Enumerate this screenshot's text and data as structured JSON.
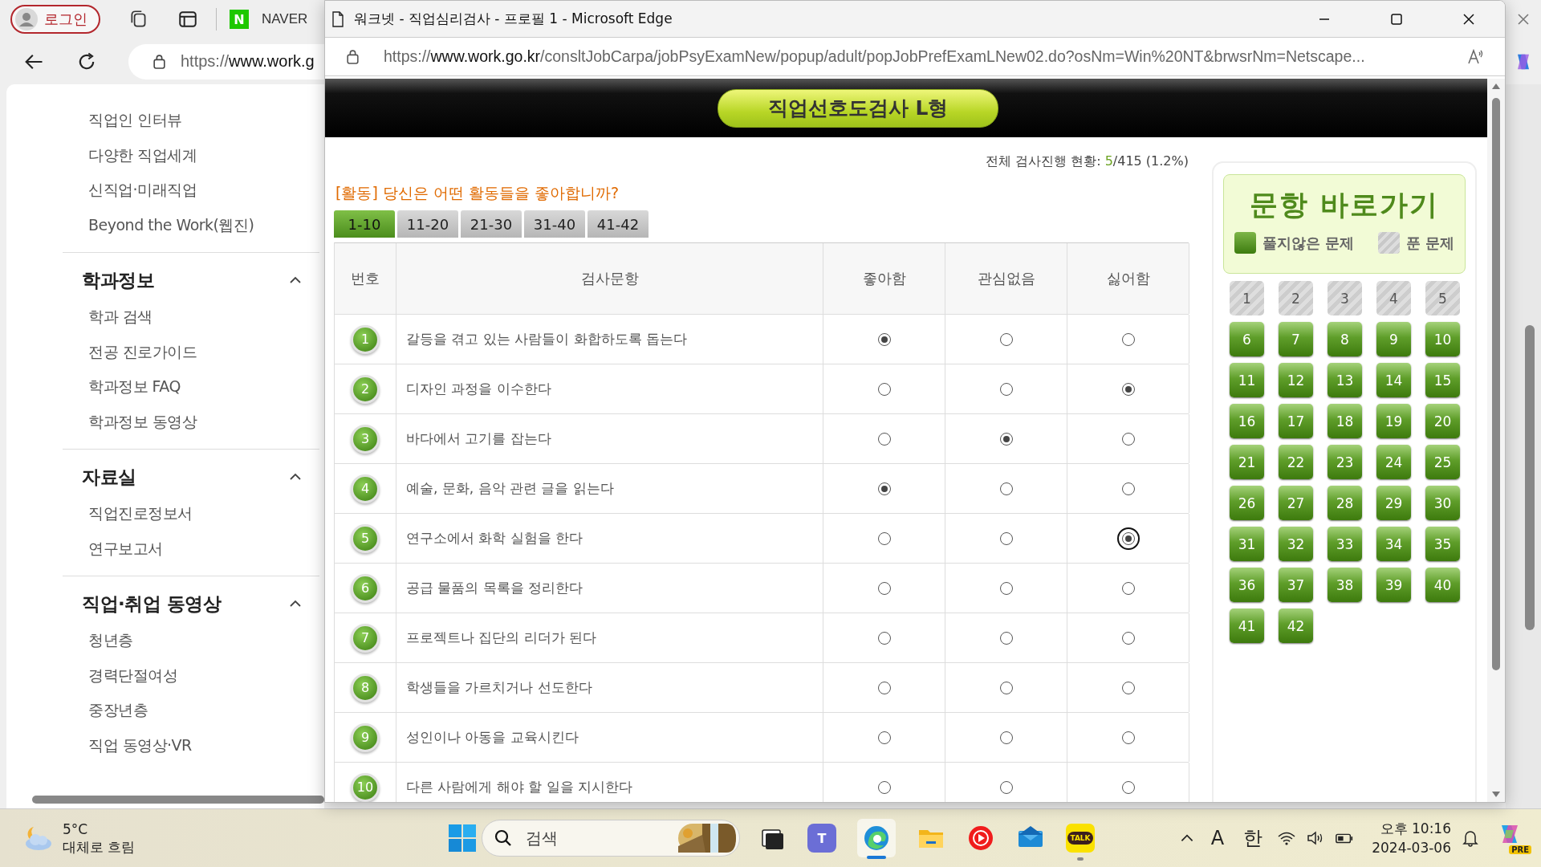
{
  "browser": {
    "login_button": "로그인",
    "naver_letter": "N",
    "bookmark": "NAVER",
    "url": {
      "scheme": "https://",
      "host": "www.work.g"
    }
  },
  "sidebar": {
    "items": [
      "직업인 인터뷰",
      "다양한 직업세계",
      "신직업·미래직업",
      "Beyond the Work(웹진)"
    ],
    "sections": [
      {
        "title": "학과정보",
        "expanded": true,
        "items": [
          "학과 검색",
          "전공 진로가이드",
          "학과정보 FAQ",
          "학과정보 동영상"
        ]
      },
      {
        "title": "자료실",
        "expanded": true,
        "items": [
          "직업진로정보서",
          "연구보고서"
        ]
      },
      {
        "title": "직업·취업 동영상",
        "expanded": true,
        "items": [
          "청년층",
          "경력단절여성",
          "중장년층",
          "직업 동영상·VR"
        ]
      }
    ]
  },
  "popup": {
    "title": "워크넷 - 직업심리검사 - 프로필 1 - Microsoft Edge",
    "url": {
      "scheme": "https://",
      "host": "www.work.go.kr",
      "path": "/consltJobCarpa/jobPsyExamNew/popup/adult/popJobPrefExamLNew02.do?osNm=Win%20NT&brwsrNm=Netscape..."
    },
    "banner": "직업선호도검사 L형",
    "progress": {
      "label": "전체 검사진행 현황: ",
      "done": "5",
      "rest": "/415 (1.2%)"
    },
    "question": "[활동] 당신은 어떤 활동들을 좋아합니까?",
    "tabs": [
      {
        "label": "1-10",
        "selected": true
      },
      {
        "label": "11-20",
        "selected": false
      },
      {
        "label": "21-30",
        "selected": false
      },
      {
        "label": "31-40",
        "selected": false
      },
      {
        "label": "41-42",
        "selected": false
      }
    ],
    "table": {
      "columns": [
        "번호",
        "검사문항",
        "좋아함",
        "관심없음",
        "싫어함"
      ],
      "rows": [
        {
          "number": "1",
          "text": "갈등을 겪고 있는 사람들이 화합하도록 돕는다",
          "choices": [
            {
              "selected": true,
              "focused": false
            },
            {
              "selected": false,
              "focused": false
            },
            {
              "selected": false,
              "focused": false
            }
          ]
        },
        {
          "number": "2",
          "text": "디자인 과정을 이수한다",
          "choices": [
            {
              "selected": false,
              "focused": false
            },
            {
              "selected": false,
              "focused": false
            },
            {
              "selected": true,
              "focused": false
            }
          ]
        },
        {
          "number": "3",
          "text": "바다에서 고기를 잡는다",
          "choices": [
            {
              "selected": false,
              "focused": false
            },
            {
              "selected": true,
              "focused": false
            },
            {
              "selected": false,
              "focused": false
            }
          ]
        },
        {
          "number": "4",
          "text": "예술, 문화, 음악 관련 글을 읽는다",
          "choices": [
            {
              "selected": true,
              "focused": false
            },
            {
              "selected": false,
              "focused": false
            },
            {
              "selected": false,
              "focused": false
            }
          ]
        },
        {
          "number": "5",
          "text": "연구소에서 화학 실험을 한다",
          "choices": [
            {
              "selected": false,
              "focused": false
            },
            {
              "selected": false,
              "focused": false
            },
            {
              "selected": true,
              "focused": true
            }
          ]
        },
        {
          "number": "6",
          "text": "공급 물품의 목록을 정리한다",
          "choices": [
            {
              "selected": false,
              "focused": false
            },
            {
              "selected": false,
              "focused": false
            },
            {
              "selected": false,
              "focused": false
            }
          ]
        },
        {
          "number": "7",
          "text": "프로젝트나 집단의 리더가 된다",
          "choices": [
            {
              "selected": false,
              "focused": false
            },
            {
              "selected": false,
              "focused": false
            },
            {
              "selected": false,
              "focused": false
            }
          ]
        },
        {
          "number": "8",
          "text": "학생들을 가르치거나 선도한다",
          "choices": [
            {
              "selected": false,
              "focused": false
            },
            {
              "selected": false,
              "focused": false
            },
            {
              "selected": false,
              "focused": false
            }
          ]
        },
        {
          "number": "9",
          "text": "성인이나 아동을 교육시킨다",
          "choices": [
            {
              "selected": false,
              "focused": false
            },
            {
              "selected": false,
              "focused": false
            },
            {
              "selected": false,
              "focused": false
            }
          ]
        },
        {
          "number": "10",
          "text": "다른 사람에게 해야 할 일을 지시한다",
          "choices": [
            {
              "selected": false,
              "focused": false
            },
            {
              "selected": false,
              "focused": false
            },
            {
              "selected": false,
              "focused": false
            }
          ]
        }
      ]
    },
    "nav": {
      "title": "문항 바로가기",
      "legend": [
        {
          "kind": "unanswered",
          "label": "풀지않은 문제"
        },
        {
          "kind": "answered",
          "label": "푼 문제"
        }
      ],
      "items": [
        {
          "label": "1",
          "answered": true
        },
        {
          "label": "2",
          "answered": true
        },
        {
          "label": "3",
          "answered": true
        },
        {
          "label": "4",
          "answered": true
        },
        {
          "label": "5",
          "answered": true
        },
        {
          "label": "6",
          "answered": false
        },
        {
          "label": "7",
          "answered": false
        },
        {
          "label": "8",
          "answered": false
        },
        {
          "label": "9",
          "answered": false
        },
        {
          "label": "10",
          "answered": false
        },
        {
          "label": "11",
          "answered": false
        },
        {
          "label": "12",
          "answered": false
        },
        {
          "label": "13",
          "answered": false
        },
        {
          "label": "14",
          "answered": false
        },
        {
          "label": "15",
          "answered": false
        },
        {
          "label": "16",
          "answered": false
        },
        {
          "label": "17",
          "answered": false
        },
        {
          "label": "18",
          "answered": false
        },
        {
          "label": "19",
          "answered": false
        },
        {
          "label": "20",
          "answered": false
        },
        {
          "label": "21",
          "answered": false
        },
        {
          "label": "22",
          "answered": false
        },
        {
          "label": "23",
          "answered": false
        },
        {
          "label": "24",
          "answered": false
        },
        {
          "label": "25",
          "answered": false
        },
        {
          "label": "26",
          "answered": false
        },
        {
          "label": "27",
          "answered": false
        },
        {
          "label": "28",
          "answered": false
        },
        {
          "label": "29",
          "answered": false
        },
        {
          "label": "30",
          "answered": false
        },
        {
          "label": "31",
          "answered": false
        },
        {
          "label": "32",
          "answered": false
        },
        {
          "label": "33",
          "answered": false
        },
        {
          "label": "34",
          "answered": false
        },
        {
          "label": "35",
          "answered": false
        },
        {
          "label": "36",
          "answered": false
        },
        {
          "label": "37",
          "answered": false
        },
        {
          "label": "38",
          "answered": false
        },
        {
          "label": "39",
          "answered": false
        },
        {
          "label": "40",
          "answered": false
        },
        {
          "label": "41",
          "answered": false
        },
        {
          "label": "42",
          "answered": false
        }
      ]
    }
  },
  "taskbar": {
    "weather": {
      "temp": "5°C",
      "condition": "대체로 흐림"
    },
    "search": {
      "placeholder": "검색"
    },
    "teams_letter": "T",
    "talk_label": "TALK",
    "ime_mode": "A",
    "ime_lang": "한",
    "time": "오후 10:16",
    "date": "2024-03-06",
    "copilot_badge": "PRE"
  }
}
